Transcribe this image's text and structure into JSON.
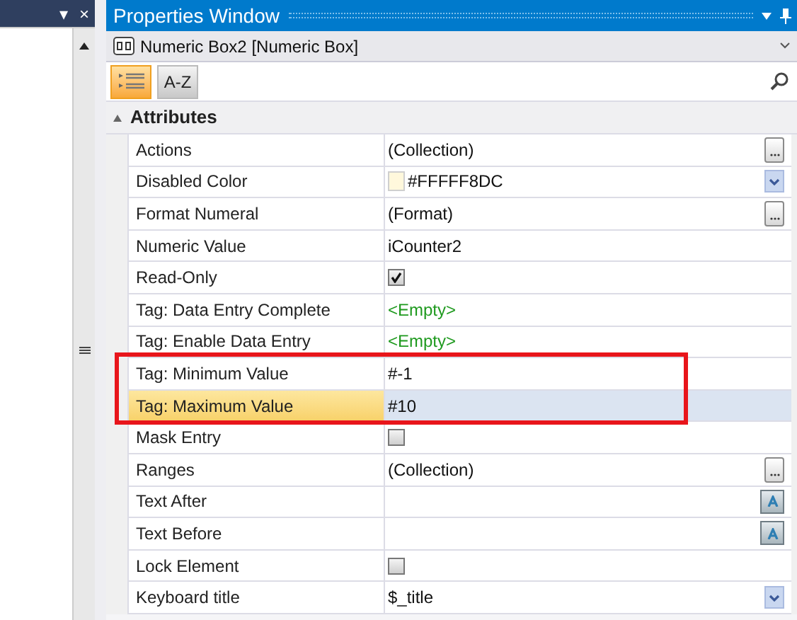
{
  "left_panel": {
    "header_icons": [
      "▾",
      "×"
    ]
  },
  "properties_window": {
    "title": "Properties Window",
    "object": "Numeric Box2 [Numeric Box]",
    "view_buttons": [
      {
        "kind": "categorized",
        "selected": true
      },
      {
        "kind": "alphabetical",
        "label": "A-Z",
        "selected": false
      }
    ],
    "category": {
      "name": "Attributes",
      "expanded": true
    },
    "rows": [
      {
        "name": "Actions",
        "kind": "text",
        "value": "(Collection)",
        "button": {
          "kind": "ellipsis"
        },
        "selected": false,
        "highlighted": false
      },
      {
        "name": "Disabled Color",
        "kind": "color",
        "value": "#FFFFF8DC",
        "color": "#fff8dc",
        "button": {
          "kind": "dropdown"
        },
        "selected": false,
        "highlighted": false
      },
      {
        "name": "Format Numeral",
        "kind": "text",
        "value": "(Format)",
        "button": {
          "kind": "ellipsis"
        },
        "selected": false,
        "highlighted": false
      },
      {
        "name": "Numeric Value",
        "kind": "text",
        "value": "iCounter2",
        "selected": false,
        "highlighted": false
      },
      {
        "name": "Read-Only",
        "kind": "checkbox",
        "checked": true,
        "selected": false,
        "highlighted": false
      },
      {
        "name": "Tag: Data Entry Complete",
        "kind": "empty",
        "value": "<Empty>",
        "selected": false,
        "highlighted": false
      },
      {
        "name": "Tag: Enable Data Entry",
        "kind": "empty",
        "value": "<Empty>",
        "selected": false,
        "highlighted": false
      },
      {
        "name": "Tag: Minimum Value",
        "kind": "text",
        "value": "#-1",
        "selected": false,
        "highlighted": true
      },
      {
        "name": "Tag: Maximum Value",
        "kind": "text",
        "value": "#10",
        "selected": true,
        "highlighted": true
      },
      {
        "name": "Mask Entry",
        "kind": "checkbox",
        "checked": false,
        "selected": false,
        "highlighted": false
      },
      {
        "name": "Ranges",
        "kind": "text",
        "value": "(Collection)",
        "button": {
          "kind": "ellipsis"
        },
        "selected": false,
        "highlighted": false
      },
      {
        "name": "Text After",
        "kind": "text",
        "button": {
          "kind": "text-editor"
        },
        "selected": false,
        "highlighted": false
      },
      {
        "name": "Text Before",
        "kind": "text",
        "button": {
          "kind": "text-editor"
        },
        "selected": false,
        "highlighted": false
      },
      {
        "name": "Lock Element",
        "kind": "checkbox",
        "checked": false,
        "selected": false,
        "highlighted": false
      },
      {
        "name": "Keyboard title",
        "kind": "text",
        "value": "$_title",
        "button": {
          "kind": "dropdown"
        },
        "selected": false,
        "highlighted": false
      }
    ]
  }
}
